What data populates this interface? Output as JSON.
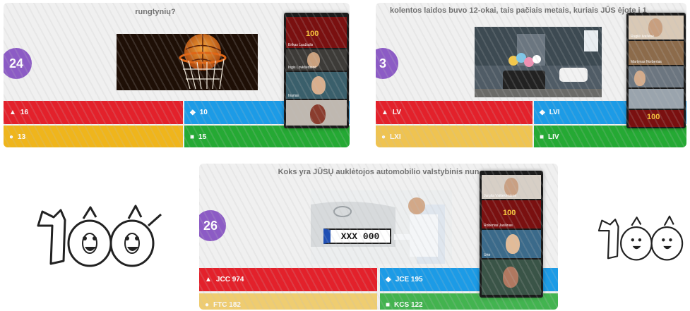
{
  "shot1": {
    "question": "rungtynių?",
    "number": "24",
    "answers": [
      {
        "symbol": "▲",
        "text": "16"
      },
      {
        "symbol": "◆",
        "text": "10"
      },
      {
        "symbol": "●",
        "text": "13"
      },
      {
        "symbol": "■",
        "text": "15"
      }
    ],
    "participants": [
      "Erikas Laužadis",
      "Ingis Lovkšėdienė",
      "Inarias"
    ],
    "hundred": "100"
  },
  "shot2": {
    "question": "kolentos laidos buvo 12-okai, tais pačiais metais, kuriais JŪS ėjote į 1",
    "number": "3",
    "answers": [
      {
        "symbol": "▲",
        "text": "LV"
      },
      {
        "symbol": "◆",
        "text": "LVI"
      },
      {
        "symbol": "●",
        "text": "LXI"
      },
      {
        "symbol": "■",
        "text": "LIV"
      }
    ],
    "participants": [
      "Rugilė Ivašėnė",
      "Martynas Norbertas"
    ],
    "hundred": "100"
  },
  "shot3": {
    "question": "Koks yra JŪSŲ auklėtojos automobilio valstybinis nun",
    "number": "26",
    "plate": "XXX 000",
    "answers": [
      {
        "symbol": "▲",
        "text": "JCC 974"
      },
      {
        "symbol": "◆",
        "text": "JCE 195"
      },
      {
        "symbol": "●",
        "text": "FTC 182"
      },
      {
        "symbol": "■",
        "text": "KCS 122"
      }
    ],
    "participants": [
      "Jurgita Vaitiekėnienė",
      "Robertas Jasilinas",
      "Urtė"
    ],
    "hundred": "100"
  },
  "logo": {
    "text": "100"
  },
  "colors": {
    "red": "#e3212b",
    "blue": "#1c9be6",
    "yellow": "#efb51c",
    "green": "#25a934",
    "purple": "#8c5bc5"
  }
}
